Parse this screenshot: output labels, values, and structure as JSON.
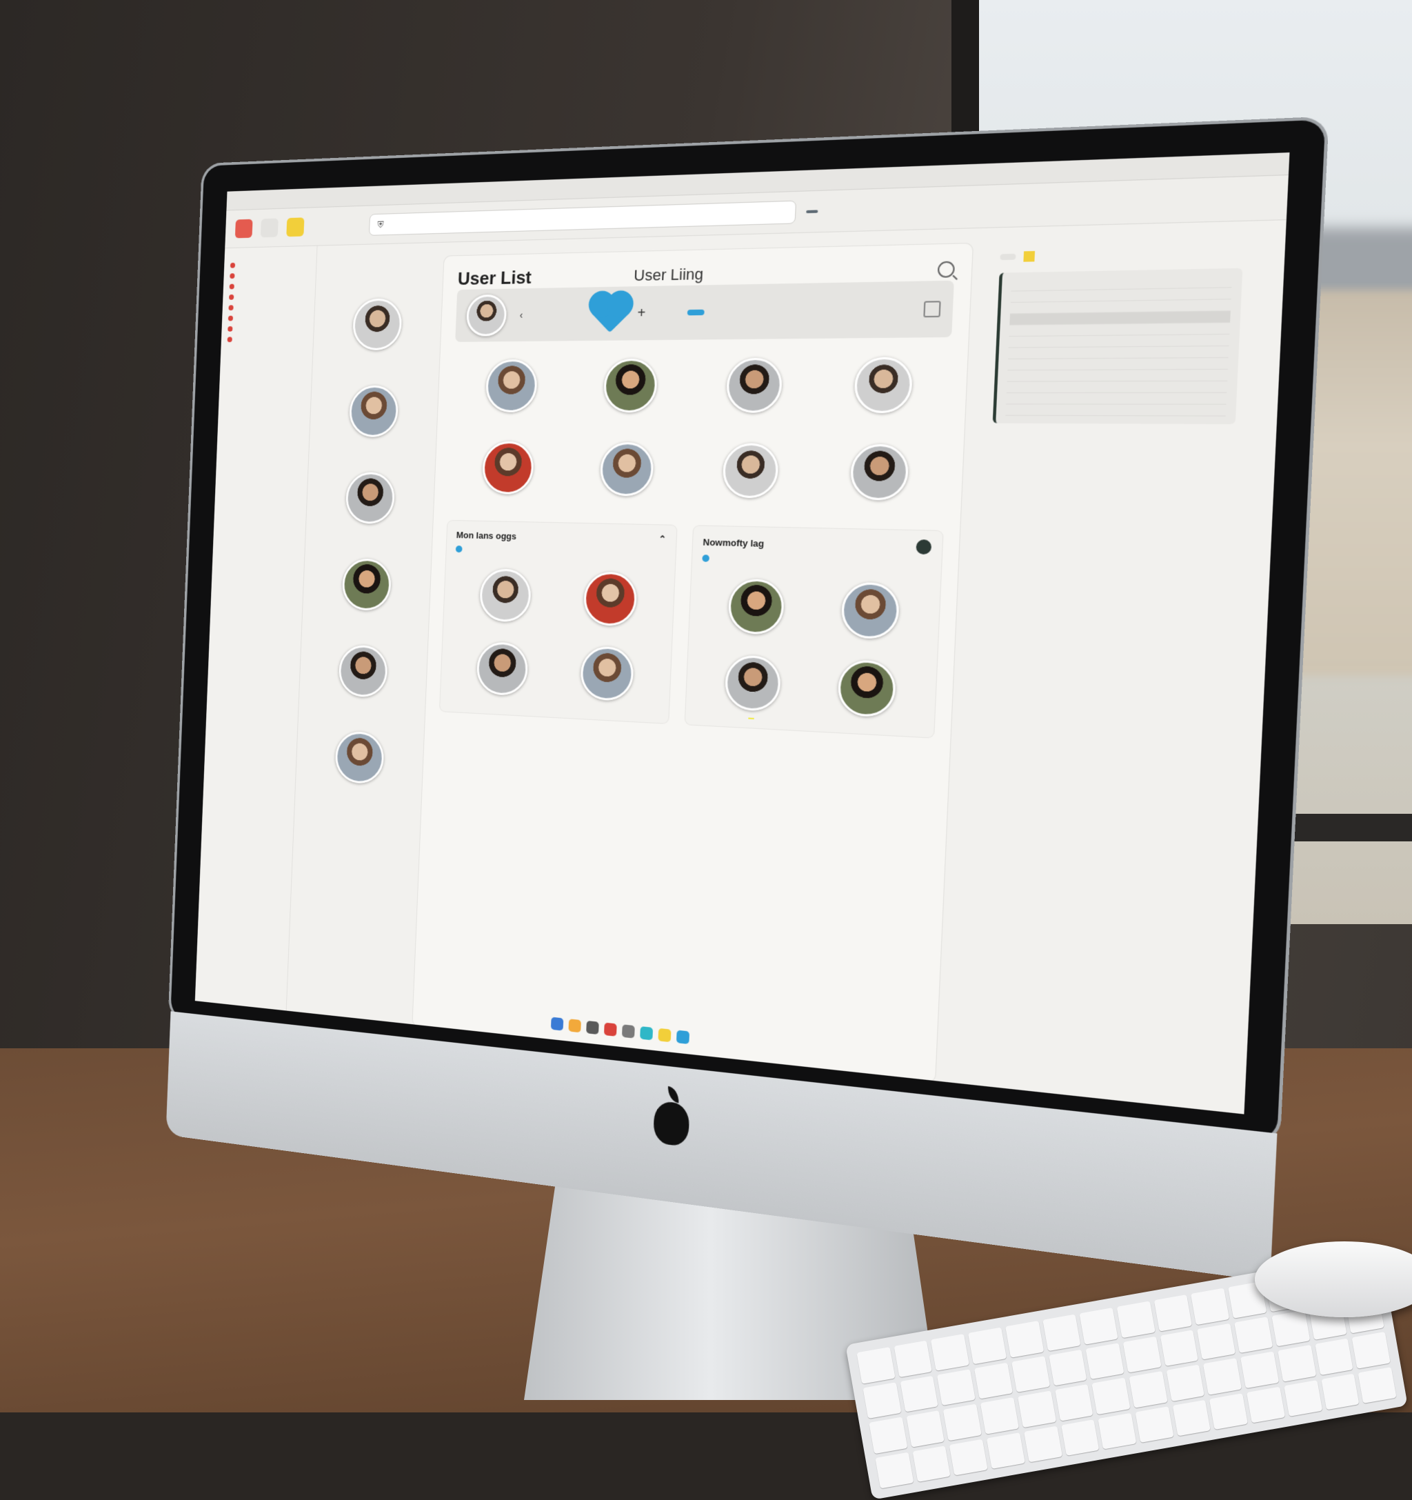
{
  "app": {
    "window_title": "",
    "url": "",
    "tab": ""
  },
  "page": {
    "title": "User List",
    "subtitle": "User Liing"
  },
  "subpanels": {
    "left_title": "Mon lans oggs",
    "right_title": "Nowmofty lag"
  },
  "colors": {
    "accent": "#2f9fd8",
    "nav_dot": "#d9433b",
    "highlight": "#f0ea4a"
  },
  "icons": [
    "search-icon",
    "heart-icon",
    "plus-icon",
    "pin-icon",
    "chevron-up-icon"
  ]
}
